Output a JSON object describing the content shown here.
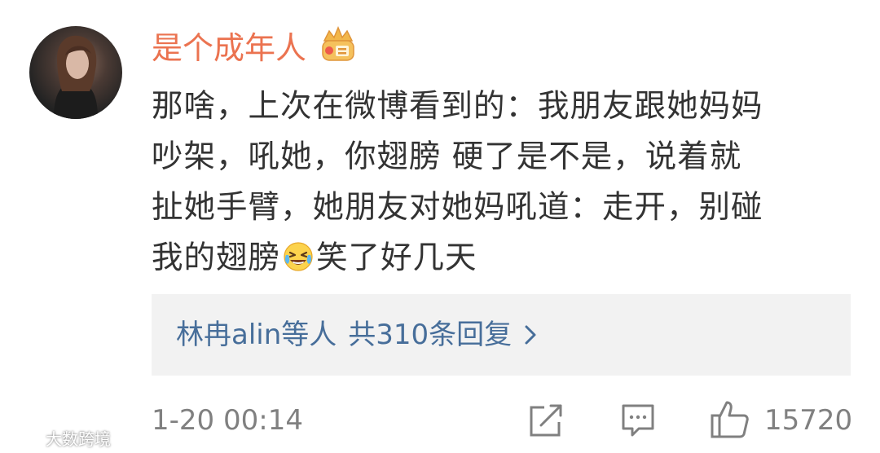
{
  "comment": {
    "username": "是个成年人",
    "badge_icon": "vip-crown-icon",
    "text_lines": [
      "那啥，上次在微博看到的：我朋友跟她妈妈",
      "吵架，吼她，你翅膀 硬了是不是，说着就",
      "扯她手臂，她朋友对她妈吼道：走开，别碰"
    ],
    "last_line_before_emoji": "我的翅膀",
    "emoji_icon": "laughing-tears-emoji",
    "last_line_after_emoji": "笑了好几天",
    "replies": {
      "names": "林冉alin等人",
      "count_text": "共310条回复"
    },
    "timestamp": "1-20 00:14",
    "like_count": "15720"
  },
  "watermark": {
    "text": "大数跨境"
  },
  "colors": {
    "username": "#eb7350",
    "link": "#476e9a",
    "text": "#333333",
    "meta": "#808080",
    "reply_bg": "#f2f2f2"
  }
}
